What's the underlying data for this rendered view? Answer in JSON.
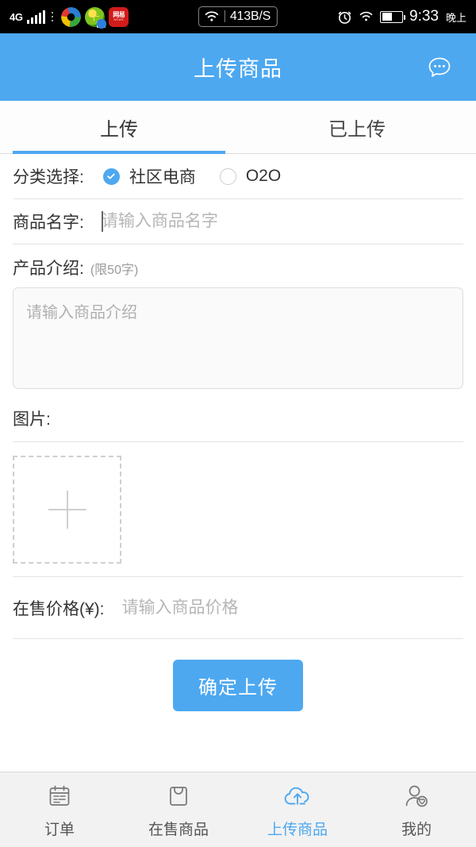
{
  "statusbar": {
    "network_type": "4G",
    "apps": [
      {
        "name": "sogou-app-icon"
      },
      {
        "name": "browser-mail-app-icon"
      },
      {
        "name": "netease-news-app-icon",
        "label": "网易",
        "sublabel": "NEWS"
      }
    ],
    "net_speed": "413B/S",
    "time": "9:33",
    "ampm": "晚上"
  },
  "header": {
    "title": "上传商品",
    "chat_icon": "chat-bubble-icon"
  },
  "tabs": [
    {
      "label": "上传",
      "active": true
    },
    {
      "label": "已上传",
      "active": false
    }
  ],
  "form": {
    "category": {
      "label": "分类选择:",
      "options": [
        {
          "label": "社区电商",
          "selected": true
        },
        {
          "label": "O2O",
          "selected": false
        }
      ]
    },
    "product_name": {
      "label": "商品名字:",
      "placeholder": "请输入商品名字",
      "value": ""
    },
    "description": {
      "label": "产品介绍:",
      "hint": "(限50字)",
      "placeholder": "请输入商品介绍",
      "value": ""
    },
    "images": {
      "label": "图片:",
      "add_icon": "plus-icon"
    },
    "price": {
      "label": "在售价格(¥):",
      "placeholder": "请输入商品价格",
      "value": ""
    },
    "submit_label": "确定上传"
  },
  "bottom_nav": [
    {
      "label": "订单",
      "icon": "calendar-icon",
      "active": false
    },
    {
      "label": "在售商品",
      "icon": "shopping-bag-icon",
      "active": false
    },
    {
      "label": "上传商品",
      "icon": "cloud-upload-icon",
      "active": true
    },
    {
      "label": "我的",
      "icon": "person-heart-icon",
      "active": false
    }
  ],
  "colors": {
    "accent": "#4da8f0",
    "text": "#333333",
    "placeholder": "#b6b6b6",
    "divider": "#e2e2e2",
    "nav_bg": "#f2f2f2"
  }
}
